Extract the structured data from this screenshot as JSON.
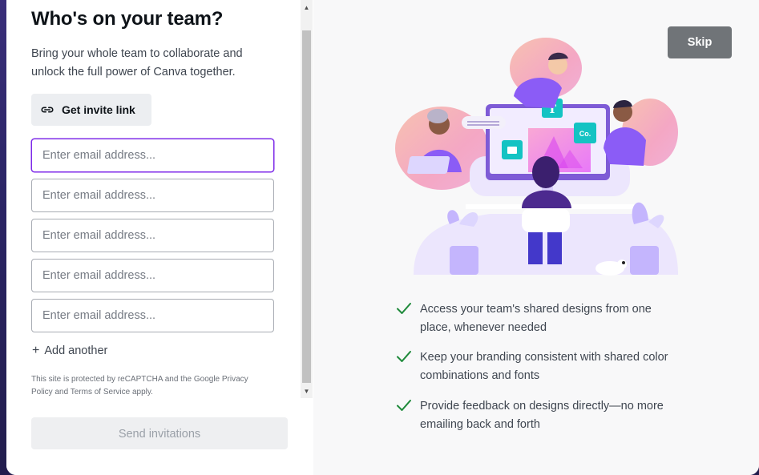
{
  "left": {
    "title": "Who's on your team?",
    "subtitle": "Bring your whole team to collaborate and unlock the full power of Canva together.",
    "invite_button_label": "Get invite link",
    "email_placeholder": "Enter email address...",
    "emails": [
      "",
      "",
      "",
      "",
      ""
    ],
    "add_another_label": "Add another",
    "recaptcha_text": "This site is protected by reCAPTCHA and the Google Privacy Policy and Terms of Service apply.",
    "send_button_label": "Send invitations"
  },
  "right": {
    "skip_label": "Skip",
    "illustration_text": {
      "text_tile": "T",
      "co_tile": "Co."
    },
    "benefits": [
      "Access your team's shared designs from one place, whenever needed",
      "Keep your branding consistent with shared color combinations and fonts",
      "Provide feedback on designs directly—no more emailing back and forth"
    ]
  },
  "colors": {
    "accent_purple": "#7d2ae8",
    "check_green": "#1f8a3b",
    "skip_bg": "#707478"
  },
  "icons": {
    "invite": "link-icon",
    "add": "plus-icon",
    "benefit": "check-icon"
  }
}
